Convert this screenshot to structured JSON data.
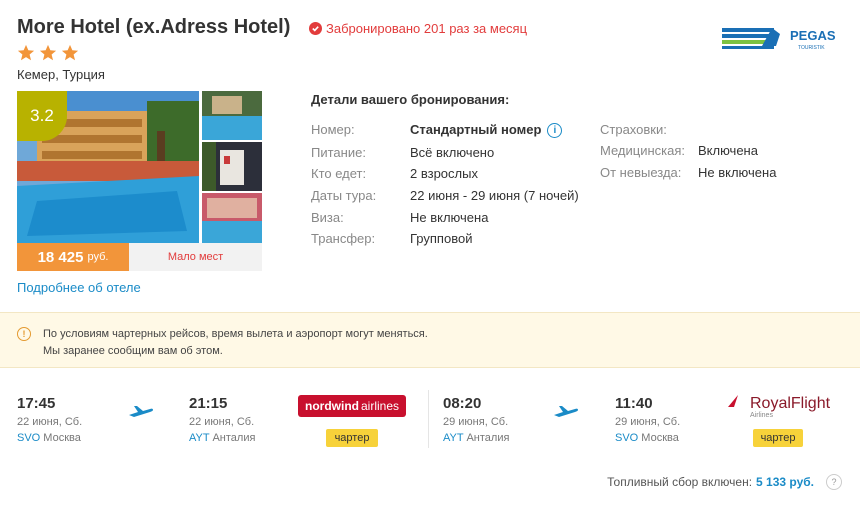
{
  "hotel": {
    "name": "More Hotel (ex.Adress Hotel)",
    "booked_text": "Забронировано 201 раз за месяц",
    "stars": 3,
    "location": "Кемер, Турция",
    "rating": "3.2",
    "price": "18 425",
    "currency": "руб.",
    "few_places": "Мало мест",
    "more_link": "Подробнее об отеле"
  },
  "operator": {
    "logo_text": "PEGAS",
    "logo_sub": "TOURISTIK"
  },
  "details": {
    "title": "Детали вашего бронирования:",
    "rows": [
      {
        "label": "Номер:",
        "value": "Стандартный номер"
      },
      {
        "label": "Питание:",
        "value": "Всё включено"
      },
      {
        "label": "Кто едет:",
        "value": "2 взрослых"
      },
      {
        "label": "Даты тура:",
        "value": "22 июня - 29 июня (7 ночей)"
      },
      {
        "label": "Виза:",
        "value": "Не включена"
      },
      {
        "label": "Трансфер:",
        "value": "Групповой"
      }
    ],
    "insurance_title": "Страховки:",
    "insurance": [
      {
        "label": "Медицинская:",
        "value": "Включена"
      },
      {
        "label": "От невыезда:",
        "value": "Не включена"
      }
    ]
  },
  "notice": {
    "line1": "По условиям чартерных рейсов, время вылета и аэропорт могут меняться.",
    "line2": "Мы заранее сообщим вам об этом."
  },
  "flights": {
    "outbound": {
      "dep_time": "17:45",
      "dep_date": "22 июня, Сб.",
      "dep_code": "SVO",
      "dep_city": "Москва",
      "arr_time": "21:15",
      "arr_date": "22 июня, Сб.",
      "arr_code": "AYT",
      "arr_city": "Анталия",
      "airline": "nordwind",
      "airline_suffix": "airlines",
      "type": "чартер"
    },
    "return": {
      "dep_time": "08:20",
      "dep_date": "29 июня, Сб.",
      "dep_code": "AYT",
      "dep_city": "Анталия",
      "arr_time": "11:40",
      "arr_date": "29 июня, Сб.",
      "arr_code": "SVO",
      "arr_city": "Москва",
      "airline": "RoyalFlight",
      "airline_suffix": "Airlines",
      "type": "чартер"
    }
  },
  "fuel": {
    "label": "Топливный сбор включен:",
    "amount": "5 133 руб.",
    "help": "?"
  },
  "colors": {
    "accent": "#1a8bc7",
    "price": "#f2953a",
    "alert": "#e23c3c",
    "rating": "#b8b200",
    "badge": "#f7d23a"
  }
}
